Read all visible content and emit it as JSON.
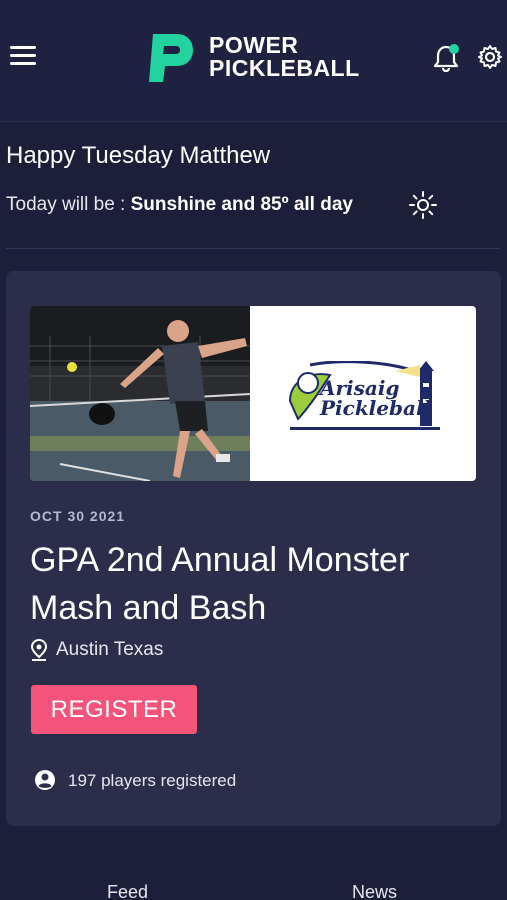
{
  "header": {
    "logo_line1": "POWER",
    "logo_line2": "PICKLEBALL",
    "icons": [
      "menu-icon",
      "bell-icon",
      "gear-icon"
    ],
    "notification_dot_color": "#22d3a0"
  },
  "greeting": {
    "text": "Happy Tuesday Matthew",
    "weather_prefix": "Today will be : ",
    "weather_value": "Sunshine and 85º all day",
    "weather_icon": "sun-icon"
  },
  "event": {
    "date": "OCT 30 2021",
    "title": "GPA 2nd Annual Monster Mash and Bash",
    "location": "Austin Texas",
    "register_label": "REGISTER",
    "players": "197 players registered",
    "sponsor_line1": "Arisaig",
    "sponsor_line2": "Pickleball"
  },
  "nav": {
    "feed": "Feed",
    "news": "News"
  },
  "colors": {
    "background": "#1d1f3a",
    "card": "#2b2d4b",
    "accent": "#22d3a0",
    "register": "#f4547a"
  }
}
